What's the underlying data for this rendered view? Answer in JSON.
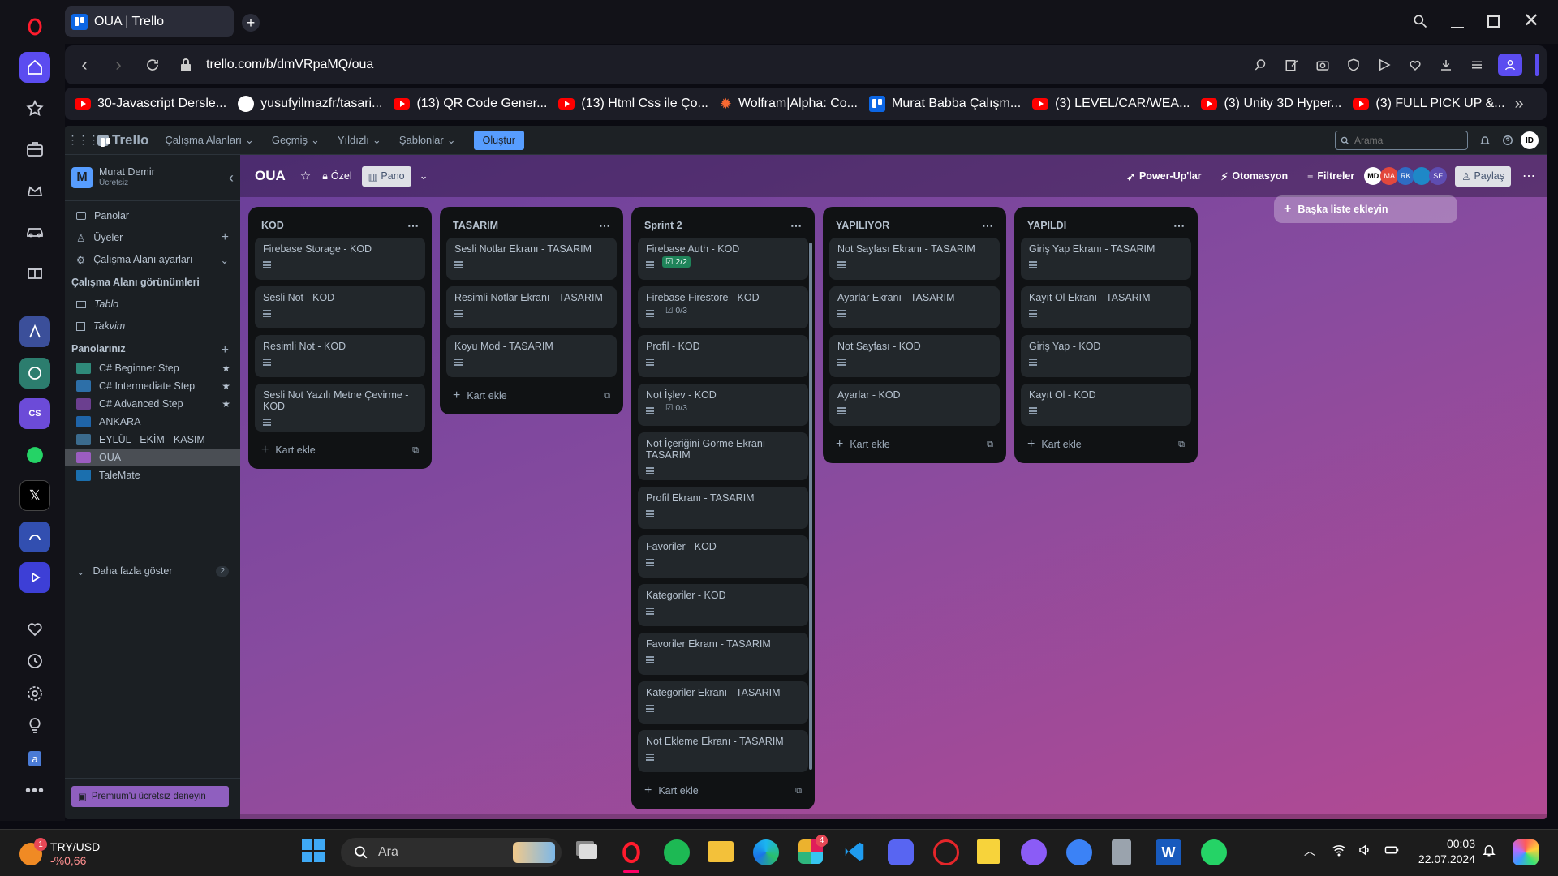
{
  "browser": {
    "tab_title": "OUA | Trello",
    "url": "trello.com/b/dmVRpaMQ/oua",
    "bookmarks": [
      "30-Javascript Dersle...",
      "yusufyilmazfr/tasari...",
      "(13) QR Code Gener...",
      "(13) Html Css ile Ço...",
      "Wolfram|Alpha: Co...",
      "Murat Babba Çalışm...",
      "(3) LEVEL/CAR/WEA...",
      "(3) Unity 3D Hyper...",
      "(3) FULL PICK UP &..."
    ]
  },
  "trello": {
    "logo": "Trello",
    "menus": [
      "Çalışma Alanları",
      "Geçmiş",
      "Yıldızlı",
      "Şablonlar"
    ],
    "create": "Oluştur",
    "search_placeholder": "Arama",
    "workspace": {
      "initial": "M",
      "name": "Murat Demir",
      "plan": "Ücretsiz"
    },
    "sidebar": {
      "boards": "Panolar",
      "members": "Üyeler",
      "settings": "Çalışma Alanı ayarları",
      "views_title": "Çalışma Alanı görünümleri",
      "views": [
        "Tablo",
        "Takvim"
      ],
      "your_boards": "Panolarınız",
      "board_list": [
        {
          "name": "C# Beginner Step",
          "color": "#2f8a7a",
          "starred": true
        },
        {
          "name": "C# Intermediate Step",
          "color": "#2d6fa8",
          "starred": true
        },
        {
          "name": "C# Advanced Step",
          "color": "#6b3f8f",
          "starred": true
        },
        {
          "name": "ANKARA",
          "color": "#1f64a8",
          "starred": false
        },
        {
          "name": "EYLÜL - EKİM - KASIM",
          "color": "#3b6b8d",
          "starred": false
        },
        {
          "name": "OUA",
          "color": "#9b5dc0",
          "starred": false
        },
        {
          "name": "TaleMate",
          "color": "#1b6fae",
          "starred": false
        }
      ],
      "show_more": "Daha fazla göster",
      "show_more_count": "2",
      "premium": "Premium'u ücretsiz deneyin"
    },
    "board": {
      "name": "OUA",
      "visibility": "Özel",
      "view": "Pano",
      "powerups": "Power-Up'lar",
      "automation": "Otomasyon",
      "filters": "Filtreler",
      "members": [
        "MD",
        "MA",
        "RK",
        "",
        "SE"
      ],
      "share": "Paylaş",
      "add_list": "Başka liste ekleyin",
      "add_card": "Kart ekle"
    },
    "lists": [
      {
        "title": "KOD",
        "cards": [
          {
            "title": "Firebase Storage - KOD"
          },
          {
            "title": "Sesli Not - KOD"
          },
          {
            "title": "Resimli Not - KOD"
          },
          {
            "title": "Sesli Not Yazılı Metne Çevirme - KOD"
          }
        ]
      },
      {
        "title": "TASARIM",
        "cards": [
          {
            "title": "Sesli Notlar Ekranı - TASARIM"
          },
          {
            "title": "Resimli Notlar Ekranı - TASARIM"
          },
          {
            "title": "Koyu Mod - TASARIM"
          }
        ]
      },
      {
        "title": "Sprint 2",
        "cards": [
          {
            "title": "Firebase Auth - KOD",
            "check": "2/2"
          },
          {
            "title": "Firebase Firestore - KOD",
            "check": "0/3"
          },
          {
            "title": "Profil - KOD"
          },
          {
            "title": "Not İşlev - KOD",
            "check": "0/3"
          },
          {
            "title": "Not İçeriğini Görme Ekranı - TASARIM"
          },
          {
            "title": "Profil Ekranı - TASARIM"
          },
          {
            "title": "Favoriler - KOD"
          },
          {
            "title": "Kategoriler - KOD"
          },
          {
            "title": "Favoriler Ekranı - TASARIM"
          },
          {
            "title": "Kategoriler Ekranı - TASARIM"
          },
          {
            "title": "Not Ekleme Ekranı - TASARIM"
          }
        ]
      },
      {
        "title": "YAPILIYOR",
        "cards": [
          {
            "title": "Not Sayfası Ekranı - TASARIM"
          },
          {
            "title": "Ayarlar Ekranı - TASARIM"
          },
          {
            "title": "Not Sayfası - KOD"
          },
          {
            "title": "Ayarlar - KOD"
          }
        ]
      },
      {
        "title": "YAPILDI",
        "cards": [
          {
            "title": "Giriş Yap Ekranı - TASARIM"
          },
          {
            "title": "Kayıt Ol Ekranı - TASARIM"
          },
          {
            "title": "Giriş Yap - KOD"
          },
          {
            "title": "Kayıt Ol - KOD"
          }
        ]
      }
    ]
  },
  "taskbar": {
    "widget_title": "TRY/USD",
    "widget_value": "-%0,66",
    "widget_badge": "1",
    "search": "Ara",
    "slack_badge": "4",
    "time": "00:03",
    "date": "22.07.2024"
  }
}
